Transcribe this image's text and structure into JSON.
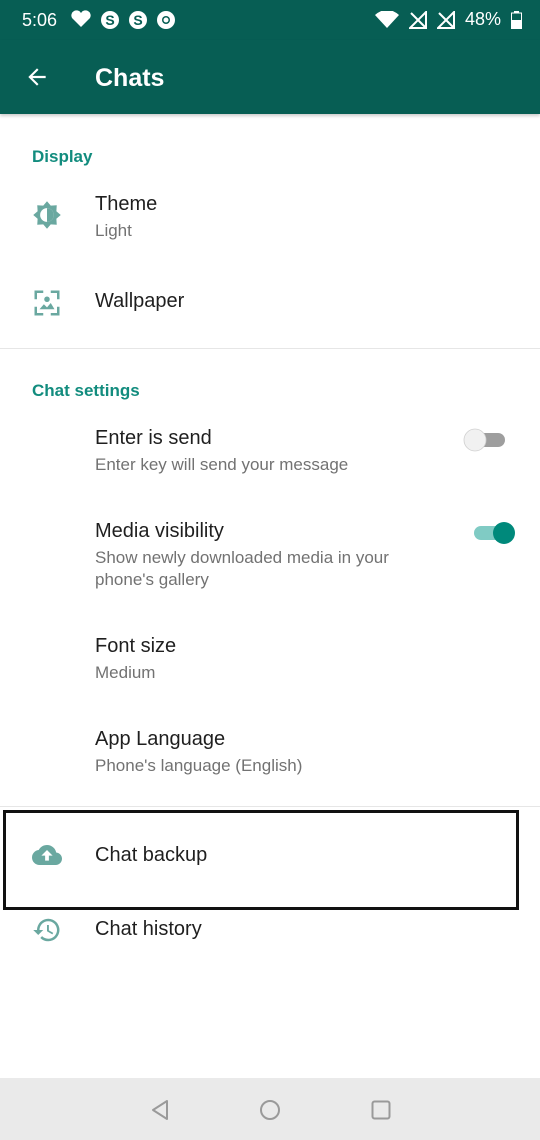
{
  "status_bar": {
    "time": "5:06",
    "battery": "48%"
  },
  "app_bar": {
    "title": "Chats"
  },
  "display": {
    "header": "Display",
    "theme": {
      "title": "Theme",
      "subtitle": "Light"
    },
    "wallpaper": {
      "title": "Wallpaper"
    }
  },
  "chat_settings": {
    "header": "Chat settings",
    "enter_is_send": {
      "title": "Enter is send",
      "subtitle": "Enter key will send your message",
      "enabled": false
    },
    "media_visibility": {
      "title": "Media visibility",
      "subtitle_line1": "Show newly downloaded media in your",
      "subtitle_line2": "phone's gallery",
      "enabled": true
    },
    "font_size": {
      "title": "Font size",
      "subtitle": "Medium"
    },
    "app_language": {
      "title": "App Language",
      "subtitle": "Phone's language (English)"
    }
  },
  "chat_backup": {
    "title": "Chat backup"
  },
  "chat_history": {
    "title": "Chat history"
  },
  "colors": {
    "primary": "#075e54",
    "accent": "#128c7e",
    "switch_on": "#00897b"
  }
}
